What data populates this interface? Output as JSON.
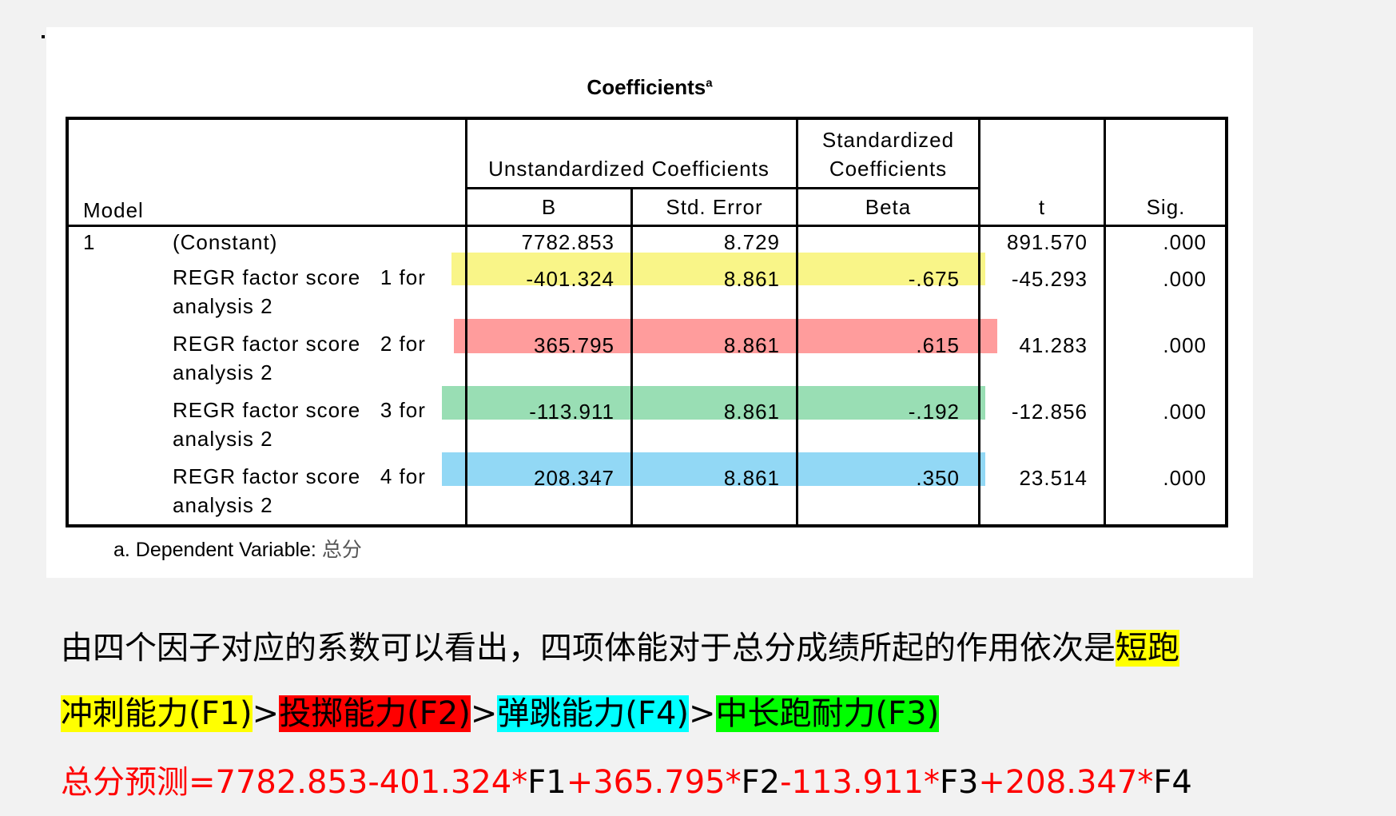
{
  "table": {
    "title": "Coefficients",
    "title_sup": "a",
    "headers": {
      "model": "Model",
      "unstd": "Unstandardized Coefficients",
      "std_line1": "Standardized",
      "std_line2": "Coefficients",
      "b": "B",
      "se": "Std. Error",
      "beta": "Beta",
      "t": "t",
      "sig": "Sig."
    },
    "rows": [
      {
        "model": "1",
        "label1": "(Constant)",
        "label2": "",
        "b": "7782.853",
        "se": "8.729",
        "beta": "",
        "t": "891.570",
        "sig": ".000"
      },
      {
        "model": "",
        "label1": "REGR factor score   1 for",
        "label2": "analysis 2",
        "b": "-401.324",
        "se": "8.861",
        "beta": "-.675",
        "t": "-45.293",
        "sig": ".000"
      },
      {
        "model": "",
        "label1": "REGR factor score   2 for",
        "label2": "analysis 2",
        "b": "365.795",
        "se": "8.861",
        "beta": ".615",
        "t": "41.283",
        "sig": ".000"
      },
      {
        "model": "",
        "label1": "REGR factor score   3 for",
        "label2": "analysis 2",
        "b": "-113.911",
        "se": "8.861",
        "beta": "-.192",
        "t": "-12.856",
        "sig": ".000"
      },
      {
        "model": "",
        "label1": "REGR factor score   4 for",
        "label2": "analysis 2",
        "b": "208.347",
        "se": "8.861",
        "beta": ".350",
        "t": "23.514",
        "sig": ".000"
      }
    ],
    "footnote_prefix": "a. Dependent Variable:",
    "footnote_var": "总分"
  },
  "conclusion": {
    "line1_text": "由四个因子对应的系数可以看出，四项体能对于总分成绩所起的作用依次是",
    "line1_hl": "短跑",
    "line2_parts": {
      "f1": "冲刺能力(F1)",
      "gt1": ">",
      "f2": "投掷能力(F2)",
      "gt2": ">",
      "f4": "弹跳能力(F4)",
      "gt3": ">",
      "f3": "中长跑耐力(F3)"
    },
    "formula": {
      "p1": "总分预测=7782.853-401.324*",
      "f1": "F1",
      "p2": "+365.795*",
      "f2": "F2",
      "p3": "-113.911*",
      "f3": "F3",
      "p4": "+208.347*",
      "f4": "F4"
    }
  },
  "colors": {
    "yellow": "#ffff00",
    "red": "#ff0000",
    "cyan": "#00ffff",
    "green": "#00ff00"
  }
}
